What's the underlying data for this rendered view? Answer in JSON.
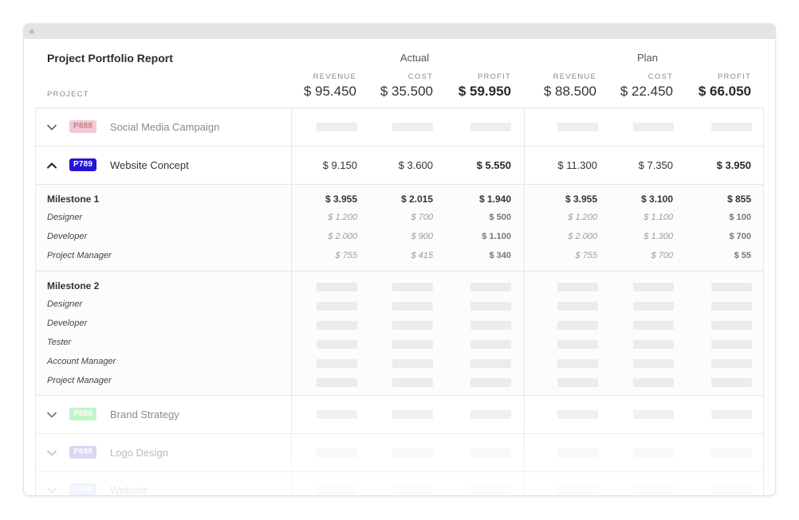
{
  "report": {
    "title": "Project Portfolio Report",
    "project_column_label": "PROJECT"
  },
  "groups": {
    "actual": "Actual",
    "plan": "Plan"
  },
  "columns": {
    "revenue": "REVENUE",
    "cost": "COST",
    "profit": "PROFIT"
  },
  "totals": {
    "actual": {
      "revenue": "$ 95.450",
      "cost": "$ 35.500",
      "profit": "$ 59.950"
    },
    "plan": {
      "revenue": "$ 88.500",
      "cost": "$ 22.450",
      "profit": "$ 66.050"
    }
  },
  "projects": [
    {
      "code": "P888",
      "name": "Social Media Campaign",
      "badge_color": "#f3c9d3",
      "badge_text_color": "#c7808f",
      "expanded": false
    },
    {
      "code": "P789",
      "name": "Website Concept",
      "badge_color": "#2415d9",
      "badge_text_color": "#ffffff",
      "expanded": true,
      "values": {
        "actual": [
          "$ 9.150",
          "$ 3.600",
          "$ 5.550"
        ],
        "plan": [
          "$ 11.300",
          "$ 7.350",
          "$ 3.950"
        ]
      }
    },
    {
      "code": "P888",
      "name": "Brand Strategy",
      "badge_color": "#b6f5c2",
      "badge_text_color": "#ffffff",
      "expanded": false
    },
    {
      "code": "P888",
      "name": "Logo Design",
      "badge_color": "#c9c2f1",
      "badge_text_color": "#ffffff",
      "expanded": false
    },
    {
      "code": "P888",
      "name": "Website",
      "badge_color": "#dfe8fb",
      "badge_text_color": "#ffffff",
      "expanded": false
    }
  ],
  "milestones": [
    {
      "title": "Milestone 1",
      "values": [
        "$ 3.955",
        "$ 2.015",
        "$ 1.940",
        "$ 3.955",
        "$ 3.100",
        "$ 855"
      ],
      "roles": [
        {
          "name": "Designer",
          "values": [
            "$ 1.200",
            "$ 700",
            "$ 500",
            "$ 1.200",
            "$ 1.100",
            "$ 100"
          ]
        },
        {
          "name": "Developer",
          "values": [
            "$ 2.000",
            "$ 900",
            "$ 1.100",
            "$ 2.000",
            "$ 1.300",
            "$ 700"
          ]
        },
        {
          "name": "Project Manager",
          "values": [
            "$ 755",
            "$ 415",
            "$ 340",
            "$ 755",
            "$ 700",
            "$ 55"
          ]
        }
      ]
    },
    {
      "title": "Milestone 2",
      "roles": [
        {
          "name": "Designer"
        },
        {
          "name": "Developer"
        },
        {
          "name": "Tester"
        },
        {
          "name": "Account Manager"
        },
        {
          "name": "Project Manager"
        }
      ]
    }
  ]
}
